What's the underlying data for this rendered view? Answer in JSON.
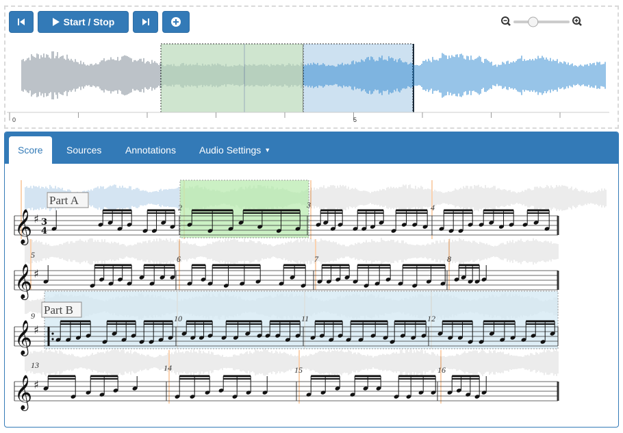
{
  "toolbar": {
    "start_stop_label": "Start / Stop",
    "prev_icon": "skip-back-icon",
    "next_icon": "skip-forward-icon",
    "add_icon": "plus-circle-icon"
  },
  "zoom": {
    "level": 0.35,
    "out_icon": "zoom-out-icon",
    "in_icon": "zoom-in-icon"
  },
  "timeline": {
    "ticks": [
      "0",
      "5"
    ]
  },
  "tabs": [
    "Score",
    "Sources",
    "Annotations",
    "Audio Settings"
  ],
  "active_tab": "Score",
  "score": {
    "sections": [
      "Part A",
      "Part B"
    ],
    "time_signature": "3/4",
    "measure_numbers": [
      "2",
      "3",
      "4",
      "5",
      "6",
      "7",
      "8",
      "9",
      "10",
      "11",
      "12",
      "13",
      "14",
      "15",
      "16"
    ]
  },
  "colors": {
    "accent": "#337ab7",
    "selection_green": "#c8e6c9",
    "selection_blue": "#c5ddf0",
    "wave_played": "#2f88d0",
    "wave_gray": "#7a8691"
  }
}
